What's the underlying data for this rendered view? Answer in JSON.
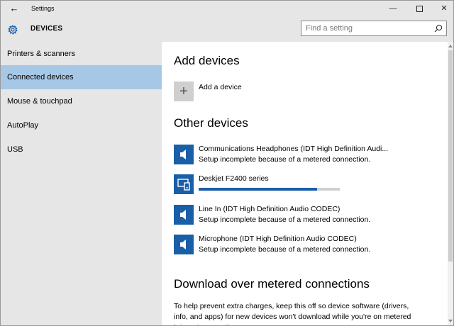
{
  "window": {
    "title": "Settings",
    "back_glyph": "←",
    "minimize_glyph": "—",
    "close_glyph": "✕"
  },
  "header": {
    "section_title": "DEVICES",
    "search_placeholder": "Find a setting"
  },
  "sidebar": {
    "items": [
      {
        "label": "Printers & scanners",
        "selected": false
      },
      {
        "label": "Connected devices",
        "selected": true
      },
      {
        "label": "Mouse & touchpad",
        "selected": false
      },
      {
        "label": "AutoPlay",
        "selected": false
      },
      {
        "label": "USB",
        "selected": false
      }
    ]
  },
  "main": {
    "add_devices_heading": "Add devices",
    "add_device_label": "Add a device",
    "add_device_glyph": "+",
    "other_devices_heading": "Other devices",
    "devices": [
      {
        "name": "Communications Headphones (IDT High Definition Audi...",
        "status": "Setup incomplete because of a metered connection.",
        "icon": "speaker-icon"
      },
      {
        "name": "Deskjet F2400 series",
        "status": "",
        "icon": "printer-icon",
        "progress": 0.84
      },
      {
        "name": "Line In (IDT High Definition Audio CODEC)",
        "status": "Setup incomplete because of a metered connection.",
        "icon": "speaker-icon"
      },
      {
        "name": "Microphone (IDT High Definition Audio CODEC)",
        "status": "Setup incomplete because of a metered connection.",
        "icon": "speaker-icon"
      }
    ],
    "download_heading": "Download over metered connections",
    "download_paragraph": "To help prevent extra charges, keep this off so device software (drivers, info, and apps) for new devices won't download while you're on metered Internet connections."
  },
  "colors": {
    "accent": "#1a5ea8",
    "selected_nav": "#a6c8e6",
    "chrome": "#e6e6e6"
  }
}
